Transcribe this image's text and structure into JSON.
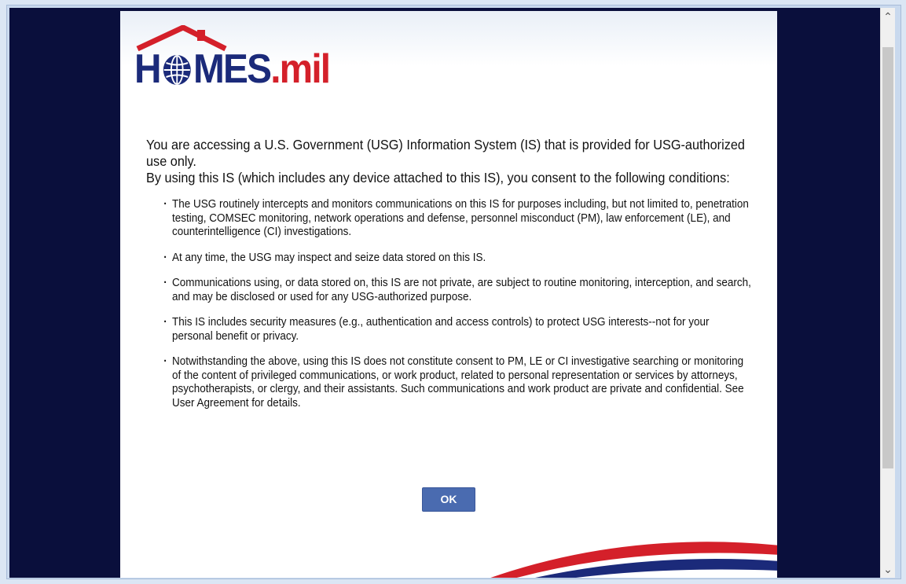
{
  "logo": {
    "prefix": "H",
    "suffix": "MES",
    "domain": ".mil"
  },
  "notice": {
    "intro_line1": "You are accessing a U.S. Government (USG) Information System (IS) that is provided for USG-authorized use only.",
    "intro_line2": "By using this IS (which includes any device attached to this IS), you consent to the following conditions:",
    "bullets": [
      "The USG routinely intercepts and monitors communications on this IS for purposes including, but not limited to, penetration testing, COMSEC monitoring, network operations and defense, personnel misconduct (PM), law enforcement (LE), and counterintelligence (CI) investigations.",
      "At any time, the USG may inspect and seize data stored on this IS.",
      "Communications using, or data stored on, this IS are not private, are subject to routine monitoring, interception, and search, and may be disclosed or used for any USG-authorized purpose.",
      "This IS includes security measures (e.g., authentication and access controls) to protect USG interests--not for your personal benefit or privacy.",
      "Notwithstanding the above, using this IS does not constitute consent to PM, LE or CI investigative searching or monitoring of the content of privileged communications, or work product, related to personal representation or services by attorneys, psychotherapists, or clergy, and their assistants. Such communications and work product are private and confidential. See User Agreement for details."
    ]
  },
  "ok_label": "OK",
  "colors": {
    "navy": "#1b2a7a",
    "red": "#d4202a",
    "button": "#4a6bb0",
    "background": "#0a0f3c"
  }
}
